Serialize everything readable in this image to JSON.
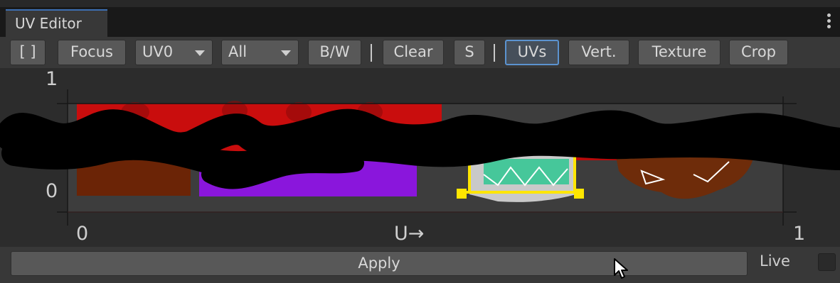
{
  "window": {
    "tab_title": "UV Editor",
    "menu_icon": "vertical-ellipsis-icon"
  },
  "toolbar": {
    "frame_label": "[ ]",
    "focus_label": "Focus",
    "uv_channel": "UV0",
    "filter": "All",
    "bw_label": "B/W",
    "clear_label": "Clear",
    "s_label": "S",
    "uvs_label": "UVs",
    "vert_label": "Vert.",
    "texture_label": "Texture",
    "crop_label": "Crop",
    "active_button": "UVs"
  },
  "canvas": {
    "v_max_label": "1",
    "v_min_label": "0",
    "u_min_label": "0",
    "u_max_label": "1",
    "u_axis_label": "U→",
    "selection_color": "#ffe600"
  },
  "bottom": {
    "apply_label": "Apply",
    "live_label": "Live",
    "live_checked": false
  },
  "colors": {
    "accent": "#5b93d0",
    "panel": "#383838",
    "button": "#585858"
  }
}
